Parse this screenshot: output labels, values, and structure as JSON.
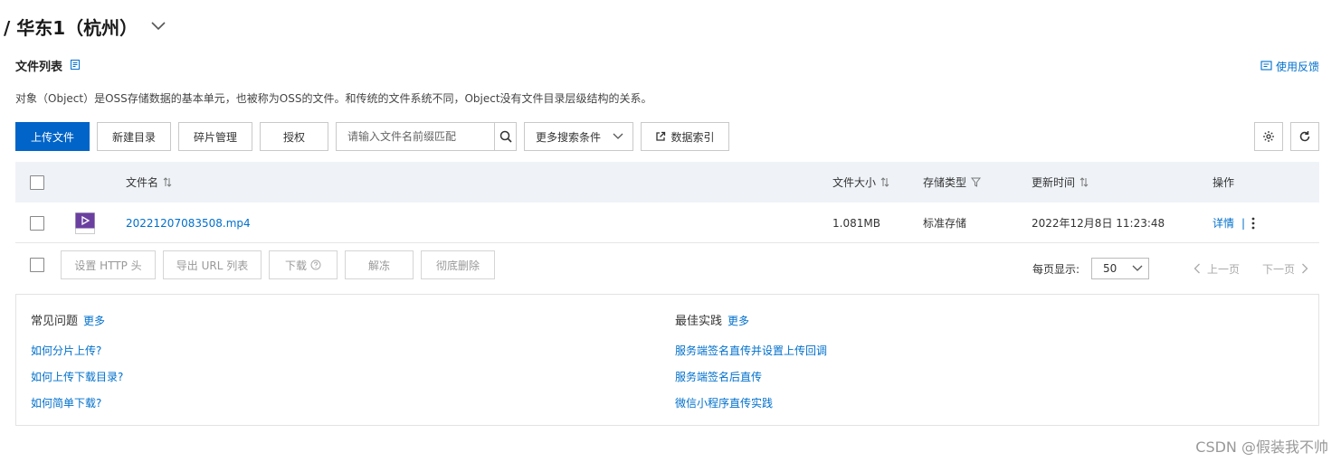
{
  "header": {
    "title": "/ 华东1（杭州）"
  },
  "file_list": {
    "heading": "文件列表",
    "feedback_label": "使用反馈",
    "description": "对象（Object）是OSS存储数据的基本单元，也被称为OSS的文件。和传统的文件系统不同，Object没有文件目录层级结构的关系。"
  },
  "toolbar": {
    "upload_label": "上传文件",
    "new_dir_label": "新建目录",
    "fragments_label": "碎片管理",
    "authorize_label": "授权",
    "search_placeholder": "请输入文件名前缀匹配",
    "more_search_label": "更多搜索条件",
    "data_index_label": "数据索引"
  },
  "table": {
    "columns": {
      "name": "文件名",
      "size": "文件大小",
      "storage": "存储类型",
      "updated": "更新时间",
      "actions": "操作"
    },
    "rows": [
      {
        "name": "20221207083508.mp4",
        "size": "1.081MB",
        "storage": "标准存储",
        "updated": "2022年12月8日 11:23:48",
        "detail_label": "详情",
        "separator": "|"
      }
    ]
  },
  "bulk": {
    "set_http_label": "设置 HTTP 头",
    "export_url_label": "导出 URL 列表",
    "download_label": "下载",
    "unfreeze_label": "解冻",
    "delete_label": "彻底删除",
    "page_size_label": "每页显示:",
    "page_size_value": "50",
    "prev_label": "上一页",
    "next_label": "下一页"
  },
  "faq": {
    "common_title": "常见问题",
    "common_more": "更多",
    "common_items": [
      "如何分片上传?",
      "如何上传下载目录?",
      "如何简单下载?"
    ],
    "best_title": "最佳实践",
    "best_more": "更多",
    "best_items": [
      "服务端签名直传并设置上传回调",
      "服务端签名后直传",
      "微信小程序直传实践"
    ]
  },
  "watermark": "CSDN @假装我不帅",
  "colors": {
    "primary": "#0064c8",
    "link": "#0070cc",
    "header_bg": "#eff3f8",
    "video_icon": "#6a3fa0"
  }
}
